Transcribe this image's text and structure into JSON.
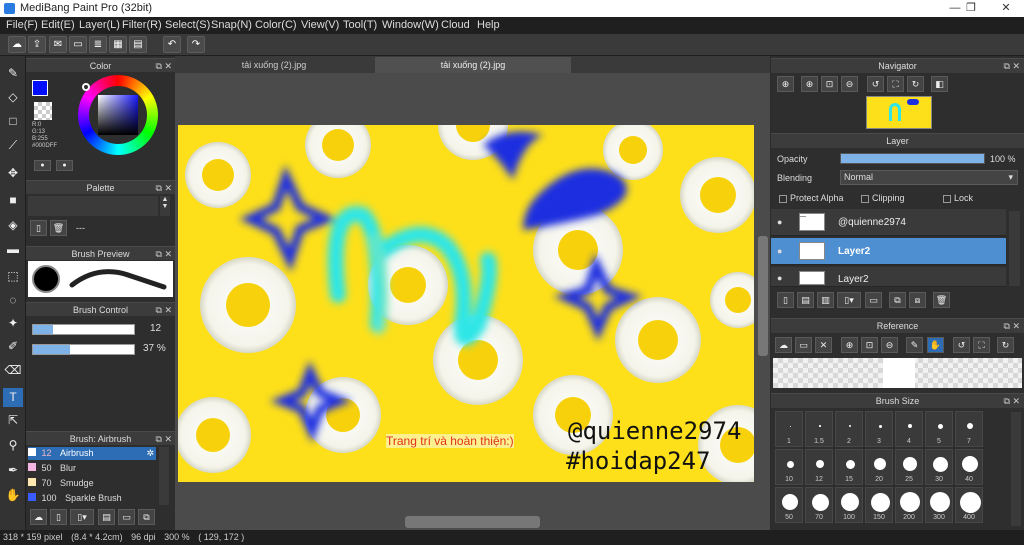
{
  "window": {
    "title": "MediBang Paint Pro (32bit)",
    "minimize": "—",
    "maximize": "❐",
    "close": "✕"
  },
  "menu": [
    "File(F)",
    "Edit(E)",
    "Layer(L)",
    "Filter(R)",
    "Select(S)",
    "Snap(N)",
    "Color(C)",
    "View(V)",
    "Tool(T)",
    "Window(W)",
    "Cloud",
    "Help"
  ],
  "tabs": [
    "tải xuống (2).jpg",
    "tải xuống (2).jpg"
  ],
  "color_panel": {
    "title": "Color",
    "r": "R:0",
    "g": "G:13",
    "b": "B:255",
    "hex": "#000DFF",
    "primary": "#000DFF",
    "secondary": "#8b1a1a"
  },
  "palette_panel": {
    "title": "Palette",
    "empty": "---"
  },
  "brush_preview_panel": {
    "title": "Brush Preview"
  },
  "brush_control_panel": {
    "title": "Brush Control",
    "size": "12",
    "opacity": "37 %",
    "size_fill": 0.2,
    "opacity_fill": 0.37
  },
  "brush_list": {
    "title": "Brush: Airbrush",
    "items": [
      {
        "size": "12",
        "name": "Airbrush",
        "color": "#ffffff"
      },
      {
        "size": "50",
        "name": "Blur",
        "color": "#f3b6e0"
      },
      {
        "size": "70",
        "name": "Smudge",
        "color": "#ffe7b0"
      },
      {
        "size": "100",
        "name": "Sparkle Brush",
        "color": "#3a5cff"
      }
    ]
  },
  "canvas": {
    "text_left": "Trang trí và hoàn thiện:)",
    "text_handle": "@quienne2974",
    "text_tag": "#hoidap247",
    "background": "#fde01a"
  },
  "navigator": {
    "title": "Navigator"
  },
  "layer_panel": {
    "title": "Layer",
    "opacity_label": "Opacity",
    "opacity_value": "100 %",
    "blending_label": "Blending",
    "blending_value": "Normal",
    "protect_alpha": "Protect Alpha",
    "clipping": "Clipping",
    "lock": "Lock",
    "layers": [
      {
        "name": "@quienne2974"
      },
      {
        "name": "Layer2"
      },
      {
        "name": "Layer2"
      }
    ]
  },
  "reference_panel": {
    "title": "Reference"
  },
  "brush_size_panel": {
    "title": "Brush Size",
    "sizes": [
      "1",
      "1.5",
      "2",
      "3",
      "4",
      "5",
      "7",
      "10",
      "12",
      "15",
      "20",
      "25",
      "30",
      "40",
      "50",
      "70",
      "100",
      "150",
      "200",
      "300",
      "400"
    ]
  },
  "status": {
    "dimensions": "318 * 159 pixel",
    "physical": "(8.4 * 4.2cm)",
    "dpi": "96 dpi",
    "zoom": "300 %",
    "coords": "( 129, 172 )"
  }
}
